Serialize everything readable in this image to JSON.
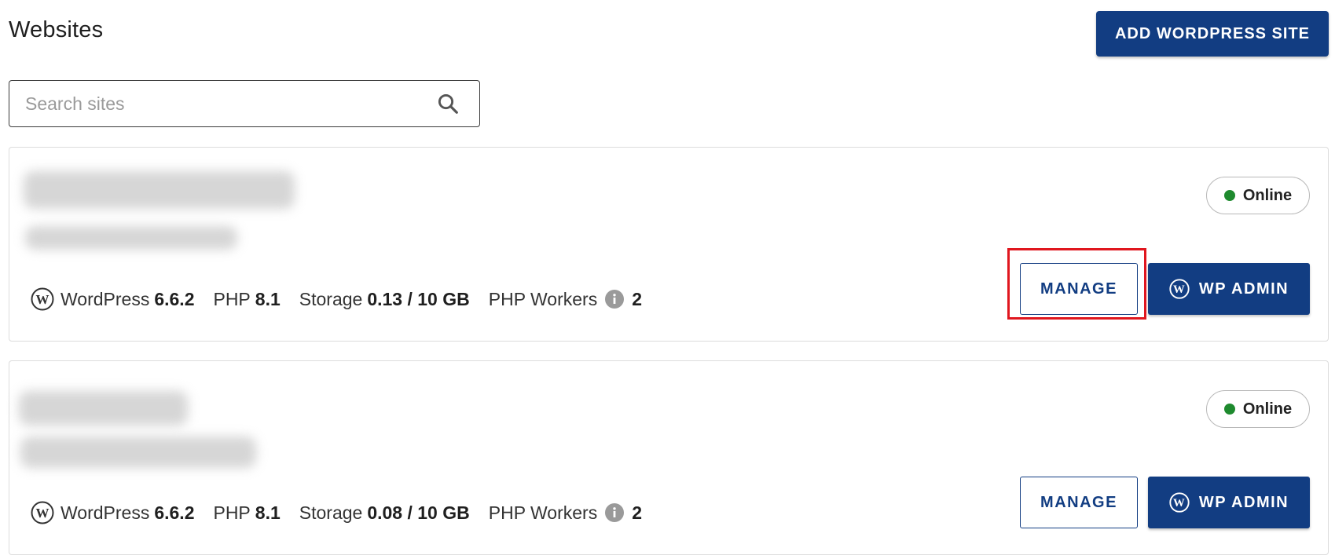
{
  "header": {
    "title": "Websites",
    "add_site_label": "ADD WORDPRESS SITE"
  },
  "search": {
    "placeholder": "Search sites",
    "value": ""
  },
  "icons": {
    "search": "search-icon",
    "wordpress": "wordpress-logo-icon",
    "info": "info-icon"
  },
  "colors": {
    "primary": "#123d82",
    "online": "#1e8a2e",
    "highlight": "#e0161e"
  },
  "sites": [
    {
      "status": "Online",
      "platform_label": "WordPress",
      "platform_version": "6.6.2",
      "php_label": "PHP",
      "php_version": "8.1",
      "storage_label": "Storage",
      "storage_value": "0.13 / 10 GB",
      "workers_label": "PHP Workers",
      "workers_value": "2",
      "manage_label": "MANAGE",
      "wp_admin_label": "WP ADMIN"
    },
    {
      "status": "Online",
      "platform_label": "WordPress",
      "platform_version": "6.6.2",
      "php_label": "PHP",
      "php_version": "8.1",
      "storage_label": "Storage",
      "storage_value": "0.08 / 10 GB",
      "workers_label": "PHP Workers",
      "workers_value": "2",
      "manage_label": "MANAGE",
      "wp_admin_label": "WP ADMIN"
    }
  ]
}
